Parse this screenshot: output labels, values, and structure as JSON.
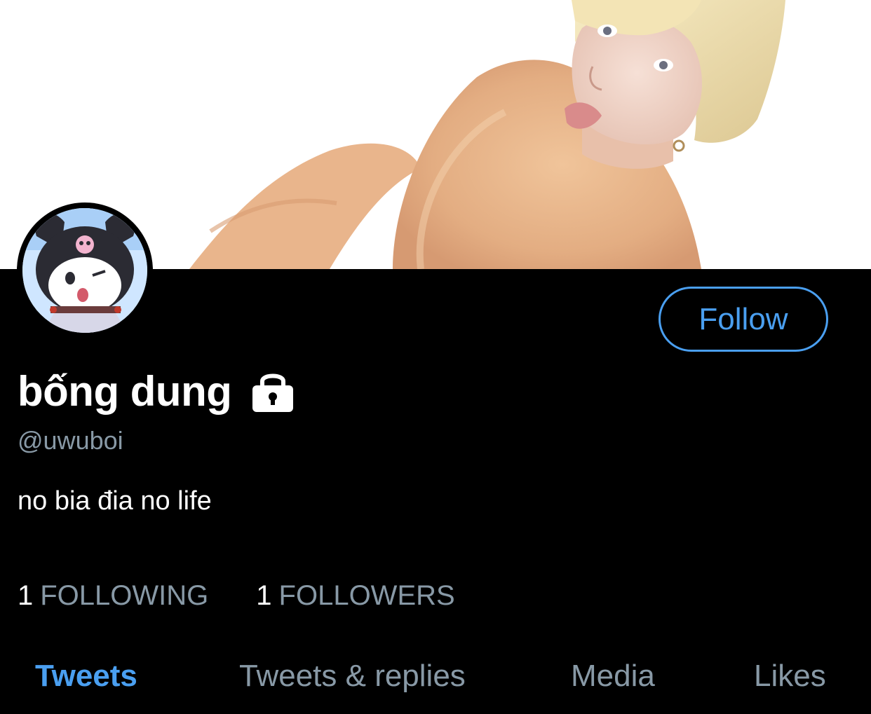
{
  "profile": {
    "display_name": "bống dung",
    "handle": "@uwuboi",
    "bio": "no bia đia no life",
    "locked": true,
    "lock_icon": "lock-icon",
    "avatar_icon": "kuromi-avatar"
  },
  "actions": {
    "follow_label": "Follow"
  },
  "stats": {
    "following_count": "1",
    "following_label": "FOLLOWING",
    "followers_count": "1",
    "followers_label": "FOLLOWERS"
  },
  "tabs": [
    {
      "label": "Tweets",
      "active": true
    },
    {
      "label": "Tweets & replies",
      "active": false
    },
    {
      "label": "Media",
      "active": false
    },
    {
      "label": "Likes",
      "active": false
    }
  ],
  "colors": {
    "accent": "#4a9ff0",
    "background": "#000000",
    "secondary_text": "#8899a6",
    "primary_text": "#ffffff"
  }
}
